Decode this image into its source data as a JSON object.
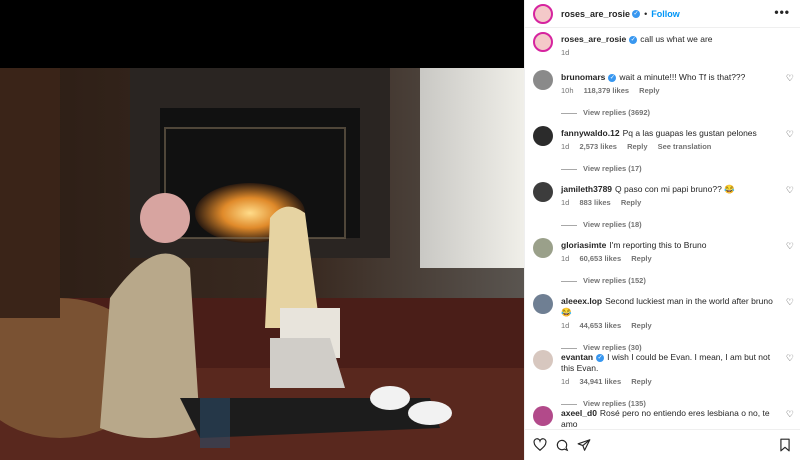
{
  "post": {
    "username": "roses_are_rosie",
    "follow_label": "Follow",
    "more_icon": "•••",
    "caption": "call us what we are",
    "caption_time": "1d"
  },
  "comments": [
    {
      "user": "brunomars",
      "verified": true,
      "text": "wait a minute!!! Who Tf is that???",
      "time": "10h",
      "likes": "118,379 likes",
      "reply": "Reply",
      "extra": "",
      "view": "View replies (3692)",
      "avatar": "#8a8a8a"
    },
    {
      "user": "fannywaldo.12",
      "verified": false,
      "text": "Pq a las guapas les gustan pelones",
      "time": "1d",
      "likes": "2,573 likes",
      "reply": "Reply",
      "extra": "See translation",
      "view": "View replies (17)",
      "avatar": "#2b2b2b"
    },
    {
      "user": "jamileth3789",
      "verified": false,
      "text": "Q paso con mi papi bruno?? 😂",
      "time": "1d",
      "likes": "883 likes",
      "reply": "Reply",
      "extra": "",
      "view": "View replies (18)",
      "avatar": "#3c3c3c"
    },
    {
      "user": "gloriasimte",
      "verified": false,
      "text": "I'm reporting this to Bruno",
      "time": "1d",
      "likes": "60,653 likes",
      "reply": "Reply",
      "extra": "",
      "view": "View replies (152)",
      "avatar": "#9aa08a"
    },
    {
      "user": "aleeex.lop",
      "verified": false,
      "text": "Second luckiest man in the world after bruno 😂",
      "time": "1d",
      "likes": "44,653 likes",
      "reply": "Reply",
      "extra": "",
      "view": "View replies (30)",
      "avatar": "#6f7f93"
    },
    {
      "user": "evantan",
      "verified": true,
      "text": "I wish I could be Evan. I mean, I am but not this Evan.",
      "time": "1d",
      "likes": "34,941 likes",
      "reply": "Reply",
      "extra": "",
      "view": "View replies (135)",
      "avatar": "#d7c7bf"
    },
    {
      "user": "axeel_d0",
      "verified": false,
      "text": "Rosé pero no entiendo eres lesbiana o no, te amo",
      "time": "",
      "likes": "",
      "reply": "",
      "extra": "",
      "view": "",
      "avatar": "#b24a8a"
    }
  ]
}
